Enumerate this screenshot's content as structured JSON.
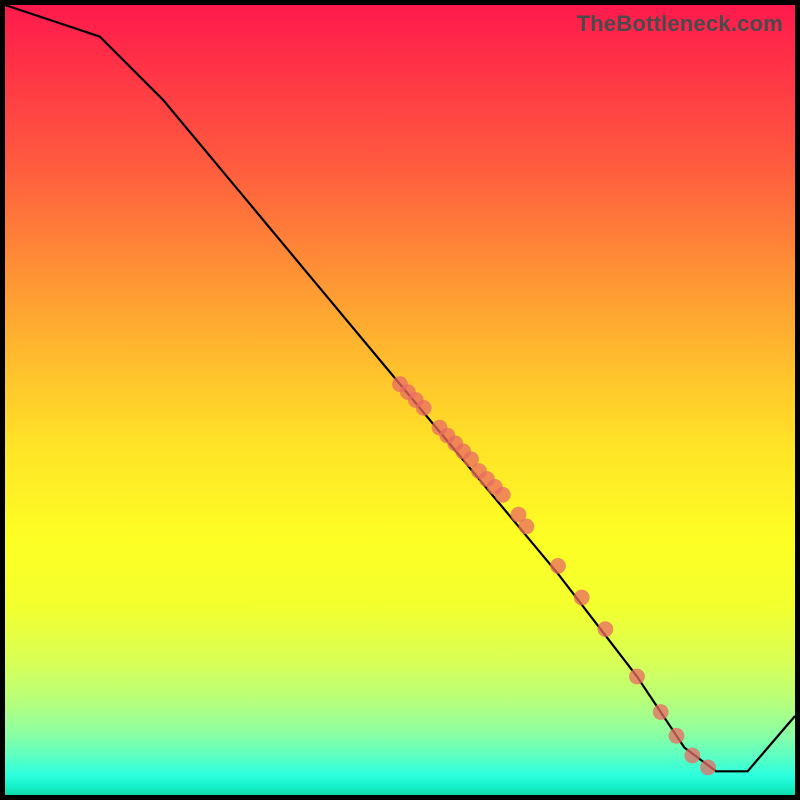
{
  "watermark": "TheBottleneck.com",
  "colors": {
    "line": "#000000",
    "dots": "#e96a63",
    "frame": "#000000"
  },
  "chart_data": {
    "type": "line",
    "title": "",
    "xlabel": "",
    "ylabel": "",
    "xlim": [
      0,
      100
    ],
    "ylim": [
      0,
      100
    ],
    "grid": false,
    "curve_xy": [
      [
        0,
        100
      ],
      [
        12,
        96
      ],
      [
        20,
        88
      ],
      [
        30,
        76
      ],
      [
        40,
        64
      ],
      [
        50,
        52
      ],
      [
        60,
        40
      ],
      [
        70,
        28
      ],
      [
        80,
        15
      ],
      [
        86,
        6
      ],
      [
        90,
        3
      ],
      [
        94,
        3
      ],
      [
        100,
        10
      ]
    ],
    "scatter_xy": [
      [
        50,
        52
      ],
      [
        51,
        51
      ],
      [
        52,
        50
      ],
      [
        53,
        49
      ],
      [
        55,
        46.5
      ],
      [
        56,
        45.5
      ],
      [
        57,
        44.5
      ],
      [
        58,
        43.5
      ],
      [
        59,
        42.5
      ],
      [
        60,
        41
      ],
      [
        61,
        40
      ],
      [
        62,
        39
      ],
      [
        63,
        38
      ],
      [
        65,
        35.5
      ],
      [
        66,
        34
      ],
      [
        70,
        29
      ],
      [
        73,
        25
      ],
      [
        76,
        21
      ],
      [
        80,
        15
      ],
      [
        83,
        10.5
      ],
      [
        85,
        7.5
      ],
      [
        87,
        5
      ],
      [
        89,
        3.5
      ]
    ],
    "dot_radius": 1.0
  }
}
